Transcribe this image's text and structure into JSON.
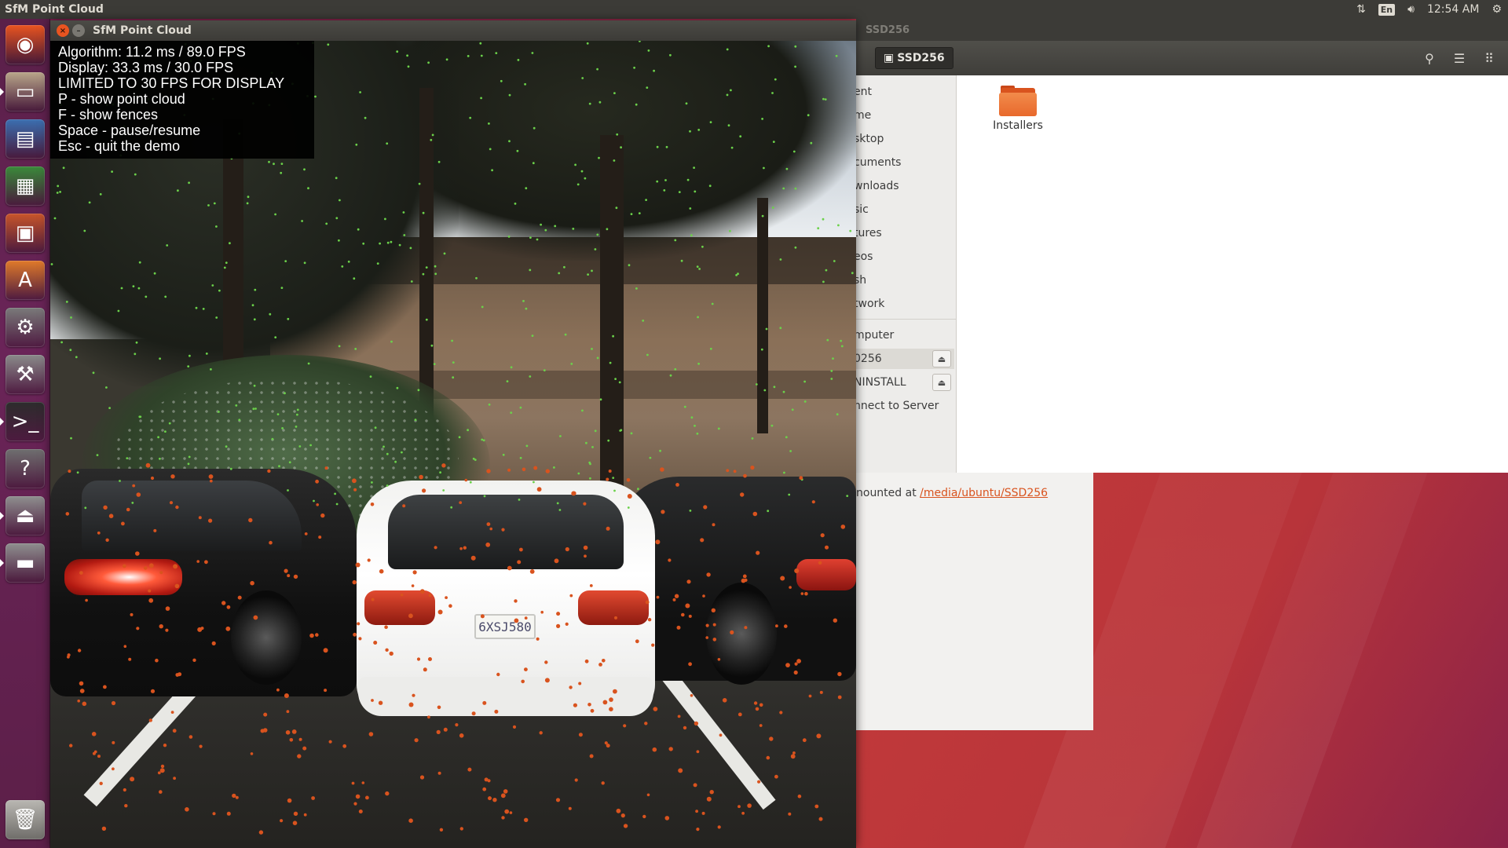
{
  "top_panel": {
    "title": "SfM Point Cloud",
    "lang": "En",
    "time": "12:54 AM",
    "icons": [
      "network-icon",
      "keyboard-icon",
      "volume-icon",
      "settings-gear-icon"
    ]
  },
  "launcher": {
    "items": [
      {
        "name": "dash-home",
        "glyph": "◉",
        "color": "#e95420"
      },
      {
        "name": "files",
        "glyph": "▭",
        "color": "#b9a68a"
      },
      {
        "name": "libreoffice-writer",
        "glyph": "▤",
        "color": "#3b6fb0"
      },
      {
        "name": "libreoffice-calc",
        "glyph": "▦",
        "color": "#3a8a3a"
      },
      {
        "name": "libreoffice-impress",
        "glyph": "▣",
        "color": "#c8552a"
      },
      {
        "name": "software-center",
        "glyph": "A",
        "color": "#e07a2a"
      },
      {
        "name": "system-settings",
        "glyph": "⚙",
        "color": "#7a7a7a"
      },
      {
        "name": "install-ubuntu",
        "glyph": "⚒",
        "color": "#8a8a8a"
      },
      {
        "name": "terminal",
        "glyph": ">_",
        "color": "#2c2c2c"
      },
      {
        "name": "help",
        "glyph": "?",
        "color": "#6f6f6f"
      },
      {
        "name": "usb-drive",
        "glyph": "⏏",
        "color": "#8f8f8f"
      },
      {
        "name": "disk-drive",
        "glyph": "▬",
        "color": "#8f8f8f"
      }
    ],
    "trash": "trash"
  },
  "file_manager": {
    "window_title": "SSD256",
    "breadcrumb": "SSD256",
    "sidebar": [
      "ent",
      "me",
      "sktop",
      "cuments",
      "wnloads",
      "sic",
      "tures",
      "eos",
      "sh",
      "twork",
      "mputer",
      "0256",
      "NINSTALL",
      "nnect to Server"
    ],
    "folder_label": "Installers"
  },
  "props_panel": {
    "text": "nounted at ",
    "link": "/media/ubuntu/SSD256"
  },
  "sfm": {
    "title": "SfM Point Cloud",
    "close_glyph": "×",
    "min_glyph": "–",
    "overlay": [
      "Algorithm: 11.2 ms / 89.0 FPS",
      "Display: 33.3 ms / 30.0 FPS",
      "LIMITED TO 30 FPS FOR DISPLAY",
      "P - show point cloud",
      "F - show fences",
      "Space - pause/resume",
      "Esc - quit the demo"
    ],
    "plate": "6XSJ580"
  },
  "colors": {
    "accent": "#e95420",
    "point_orange": "#d9531e",
    "point_green": "#6bd14a"
  }
}
